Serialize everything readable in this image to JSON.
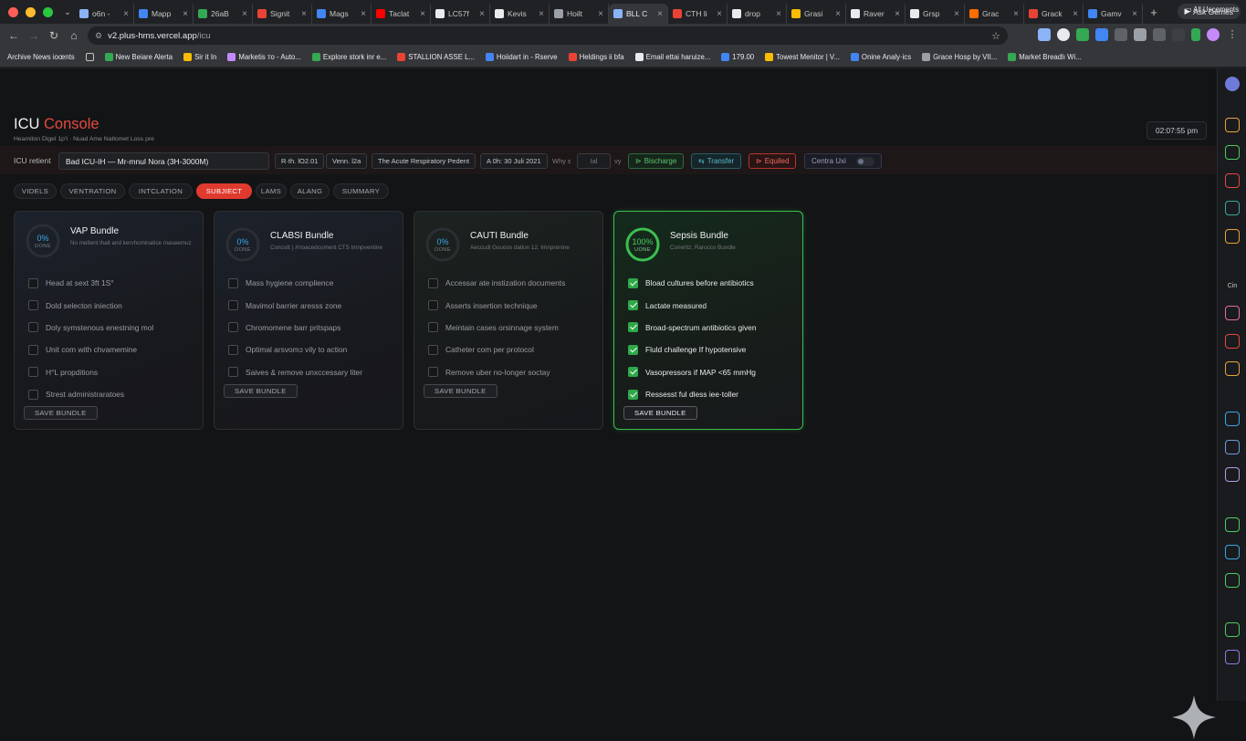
{
  "browser": {
    "tabs": [
      {
        "label": "o6n -",
        "color": "#8ab4f8"
      },
      {
        "label": "Mapp",
        "color": "#4285f4"
      },
      {
        "label": "26aB",
        "color": "#34a853"
      },
      {
        "label": "Signit",
        "color": "#ea4335"
      },
      {
        "label": "Mags",
        "color": "#4285f4"
      },
      {
        "label": "Taclat",
        "color": "#ff0000"
      },
      {
        "label": "LC57f",
        "color": "#e8eaed"
      },
      {
        "label": "Kevis",
        "color": "#e8eaed"
      },
      {
        "label": "Hoilt",
        "color": "#9aa0a6"
      },
      {
        "label": "BLL C",
        "color": "#8ab4f8"
      },
      {
        "label": "CTH li",
        "color": "#ea4335"
      },
      {
        "label": "drop",
        "color": "#e8eaed"
      },
      {
        "label": "Grasi",
        "color": "#fbbc04"
      },
      {
        "label": "Raver",
        "color": "#e8eaed"
      },
      {
        "label": "Grsp",
        "color": "#e8eaed"
      },
      {
        "label": "Grac",
        "color": "#ff6d00"
      },
      {
        "label": "Grack",
        "color": "#ea4335"
      },
      {
        "label": "Gamv",
        "color": "#4285f4"
      }
    ],
    "active_tab_index": 9,
    "ask_label": "Ask Gemes",
    "url_host": "v2.plus-hms.vercel.app",
    "url_path": "/icu",
    "bookmarks": [
      "Archive News ioœnts",
      "New Beiare Alerta",
      "Sir it In",
      "Marketis ᴛo - Auto...",
      "Explore stork inr e...",
      "STALLION ASSE L...",
      "Hoiidart in - Rserve",
      "Heldings ii bfa",
      "Email ettai haruize...",
      "179.00",
      "Towest Menitor | V...",
      "Onine Analy·ics",
      "Grace Hosp by VII...",
      "Market Breadlı Wi..."
    ],
    "all_bookmarks_label": "All Uscements"
  },
  "header": {
    "title_main": "ICU",
    "title_accent": "Console",
    "subtitle": "Heamiton Digel 1p'I · Nuad Ame Natlomet Loss pre",
    "clock": "02:07:55 pm"
  },
  "patient_bar": {
    "label": "ICU retient",
    "patient": "Bad ICU-IH — Mr-mnul Nora (3H-3000M)",
    "chips": [
      "R·th. lO2.01",
      "Venn. l2a",
      "The Acute Respiratory Pedent",
      "A 0h: 30 Juli 2021"
    ],
    "why_label": "Why ε",
    "why_value": "Ial",
    "why_suffix": "vy",
    "discharge": "Bischarge",
    "transfer": "Transfer",
    "equiled": "Equiled",
    "central": "Centra Uxi"
  },
  "tabs": [
    "VIDELS",
    "VENTRATION",
    "INTCLATION",
    "SUBJIECT",
    "LAMS",
    "ALANG",
    "SUMMARY"
  ],
  "active_tab": 3,
  "bundles": [
    {
      "title": "VAP Bundle",
      "desc": "No metlent lhait and kervhominatice maseemuz",
      "percent": "0%",
      "done_label": "DONE",
      "progress": 0,
      "items": [
        {
          "label": "Head at sext 3ft 1S°",
          "checked": false
        },
        {
          "label": "Dold selecton iniection",
          "checked": false
        },
        {
          "label": "Doly symstenous enestning mol",
          "checked": false
        },
        {
          "label": "Unit com with chvamemine",
          "checked": false
        },
        {
          "label": "H°L propditions",
          "checked": false
        },
        {
          "label": "Strest administraratoes",
          "checked": false
        }
      ],
      "save_label": "SAVE BUNDLE"
    },
    {
      "title": "CLABSI Bundle",
      "desc": "Concott ) /rnoacedcoment CTS Imnpventine",
      "percent": "0%",
      "done_label": "DONE",
      "progress": 0,
      "items": [
        {
          "label": "Mass hygiene complience",
          "checked": false
        },
        {
          "label": "Mavimol barrier aresss zone",
          "checked": false
        },
        {
          "label": "Chromomene barr pritspaps",
          "checked": false
        },
        {
          "label": "Optimal arsvomɔ vily to action",
          "checked": false
        },
        {
          "label": "Saives & remove unxccessary liter",
          "checked": false
        }
      ],
      "save_label": "SAVE BUNDLE"
    },
    {
      "title": "CAUTI Bundle",
      "desc": "Aeccudl Gouoos dation 12, Imnprenine",
      "percent": "0%",
      "done_label": "DONE",
      "progress": 0,
      "items": [
        {
          "label": "Accessar ate instization documents",
          "checked": false
        },
        {
          "label": "Asserts insertion technique",
          "checked": false
        },
        {
          "label": "Meintain cases orsinnage system",
          "checked": false
        },
        {
          "label": "Catheter com per protocol",
          "checked": false
        },
        {
          "label": "Remove uber no-longer soctay",
          "checked": false
        }
      ],
      "save_label": "SAVE BUNDLE"
    },
    {
      "title": "Sepsis Bundle",
      "desc": "Corieritz, Rarocco Bundle",
      "percent": "100%",
      "done_label": "UONE",
      "progress": 1,
      "items": [
        {
          "label": "Bload cultures before antibiotics",
          "checked": true
        },
        {
          "label": "Lactate measured",
          "checked": true
        },
        {
          "label": "Broad-spectrum antibiotics given",
          "checked": true
        },
        {
          "label": "Fluld challenge If hypotensive",
          "checked": true
        },
        {
          "label": "Vasopressors if MAP <65 mmHg",
          "checked": true
        },
        {
          "label": "Ressesst ful dless iee·toller",
          "checked": true
        }
      ],
      "save_label": "SAVE BUNDLE"
    }
  ],
  "colors": {
    "accent_red": "#e5483e",
    "ring_blue": "#3aa7e8",
    "done_green": "#3bbf4f"
  },
  "right_sidebar_icons": [
    "profile-icon",
    "r-icon",
    "people-icon",
    "bug-icon",
    "refresh-icon",
    "note-icon",
    "cin-icon",
    "heart-icon",
    "heart-outline-icon",
    "edit-icon",
    "triangle-icon",
    "doc-icon",
    "pen-icon",
    "users-icon",
    "network-icon",
    "image-icon",
    "link-icon",
    "square-icon"
  ],
  "right_sidebar_cin": "Cin"
}
